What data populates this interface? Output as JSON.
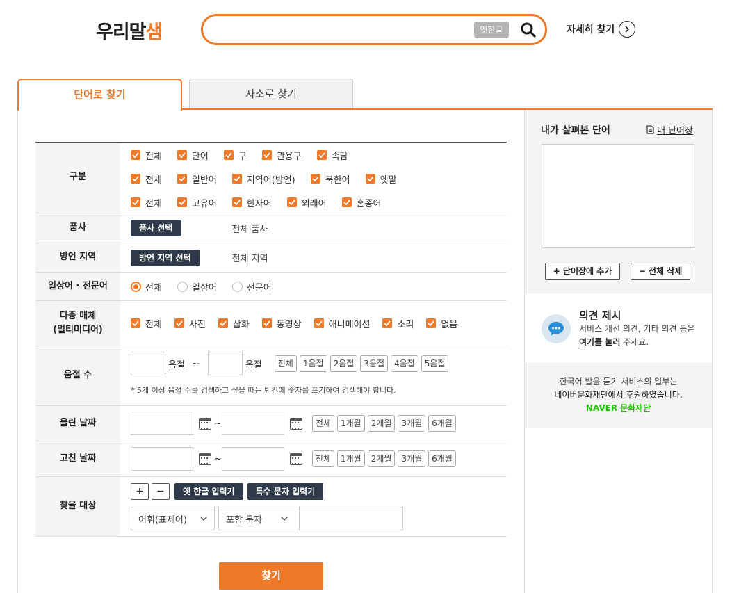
{
  "header": {
    "logo_text": "우리말",
    "logo_accent": "샘",
    "search_placeholder": "",
    "old_hangul_label": "옛한글",
    "advanced_search": "자세히 찾기"
  },
  "tabs": [
    {
      "label": "단어로 찾기"
    },
    {
      "label": "자소로 찾기"
    }
  ],
  "form": {
    "category": {
      "label": "구분",
      "rows": [
        [
          "전체",
          "단어",
          "구",
          "관용구",
          "속담"
        ],
        [
          "전체",
          "일반어",
          "지역어(방언)",
          "북한어",
          "옛말"
        ],
        [
          "전체",
          "고유어",
          "한자어",
          "외래어",
          "혼종어"
        ]
      ]
    },
    "pos": {
      "label": "품사",
      "button": "품사 선택",
      "value": "전체 품사"
    },
    "dialect": {
      "label": "방언 지역",
      "button": "방언 지역 선택",
      "value": "전체 지역"
    },
    "usage": {
      "label": "일상어 · 전문어",
      "options": [
        "전체",
        "일상어",
        "전문어"
      ]
    },
    "media": {
      "label_line1": "다중 매체",
      "label_line2": "(멀티미디어)",
      "options": [
        "전체",
        "사진",
        "삽화",
        "동영상",
        "애니메이션",
        "소리",
        "없음"
      ]
    },
    "syllables": {
      "label": "음절 수",
      "unit": "음절",
      "tilde": "~",
      "buttons": [
        "전체",
        "1음절",
        "2음절",
        "3음절",
        "4음절",
        "5음절"
      ],
      "note": "* 5개 이상 음절 수를 검색하고 싶을 때는 빈칸에 숫자를 표기하여 검색해야 합니다."
    },
    "uploaded": {
      "label": "올린 날짜",
      "buttons": [
        "전체",
        "1개월",
        "2개월",
        "3개월",
        "6개월"
      ]
    },
    "modified": {
      "label": "고친 날짜",
      "buttons": [
        "전체",
        "1개월",
        "2개월",
        "3개월",
        "6개월"
      ]
    },
    "target": {
      "label": "찾을 대상",
      "plus": "+",
      "minus": "−",
      "old_hangul_input": "옛 한글 입력기",
      "special_input": "특수 문자 입력기",
      "select1": "어휘(표제어)",
      "select2": "포함 문자"
    },
    "submit": "찾기"
  },
  "sidebar": {
    "title": "내가 살펴본 단어",
    "my_words": "내 단어장",
    "add_button": "+ 단어장에 추가",
    "delete_button": "− 전체 삭제",
    "opinion_title": "의견 제시",
    "opinion_text1": "서비스 개선 의견, 기타 의견 등은",
    "opinion_link": "여기를 눌러",
    "opinion_text2": " 주세요.",
    "sponsor_line1": "한국어 발음 듣기 서비스의 일부는",
    "sponsor_line2": "네이버문화재단에서 후원하였습니다.",
    "naver": "NAVER",
    "naver_foundation": "문화재단"
  },
  "colors": {
    "accent": "#ef7a2a",
    "dark_button": "#2f3b4a",
    "naver_green": "#1ec800"
  }
}
